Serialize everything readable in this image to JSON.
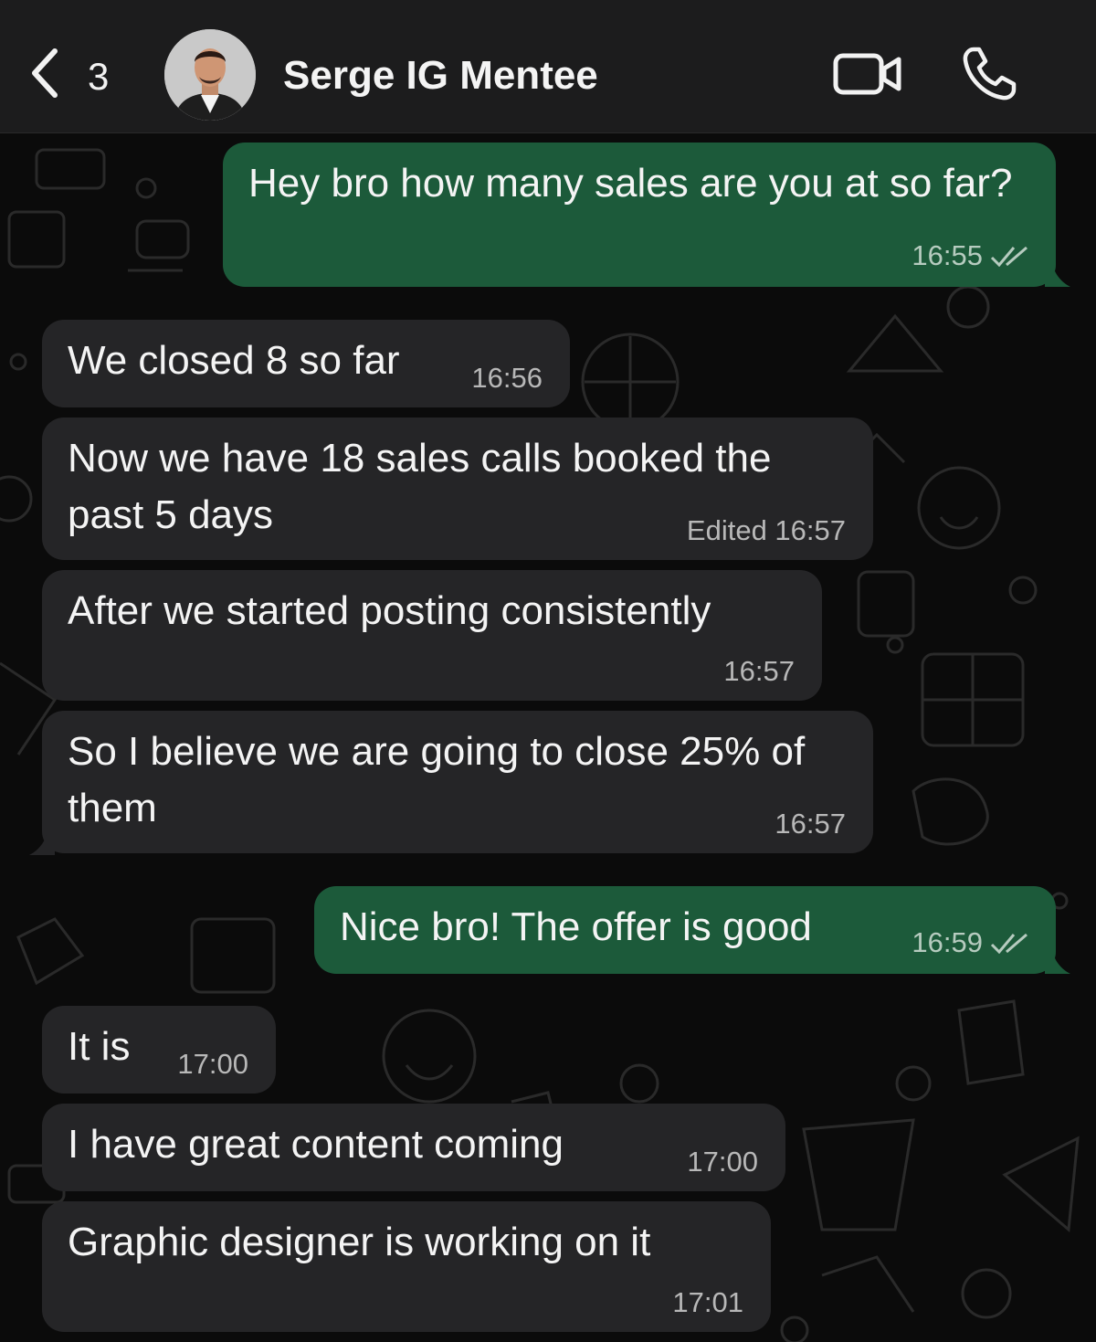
{
  "header": {
    "back_icon": "chevron-left-icon",
    "unread_count": "3",
    "contact_name": "Serge IG Mentee",
    "video_icon": "video-camera-icon",
    "call_icon": "phone-icon"
  },
  "colors": {
    "outgoing_bubble": "#1c5a3a",
    "incoming_bubble": "#252527",
    "header_bg": "#1c1c1d",
    "chat_bg": "#0b0b0b"
  },
  "messages": [
    {
      "direction": "out",
      "text": "Hey bro how many sales are you at so far?",
      "time": "16:55",
      "status": "read"
    },
    {
      "direction": "in",
      "text": "We closed 8 so far",
      "time": "16:56"
    },
    {
      "direction": "in",
      "text": "Now we have 18 sales calls booked the past 5 days",
      "time": "Edited 16:57"
    },
    {
      "direction": "in",
      "text": "After we started posting consistently",
      "time": "16:57"
    },
    {
      "direction": "in",
      "text": "So I believe we are going to close 25% of them",
      "time": "16:57"
    },
    {
      "direction": "out",
      "text": "Nice bro! The offer is good",
      "time": "16:59",
      "status": "read"
    },
    {
      "direction": "in",
      "text": "It is",
      "time": "17:00"
    },
    {
      "direction": "in",
      "text": "I have great content coming",
      "time": "17:00"
    },
    {
      "direction": "in",
      "text": "Graphic designer is working on it",
      "time": "17:01"
    }
  ]
}
